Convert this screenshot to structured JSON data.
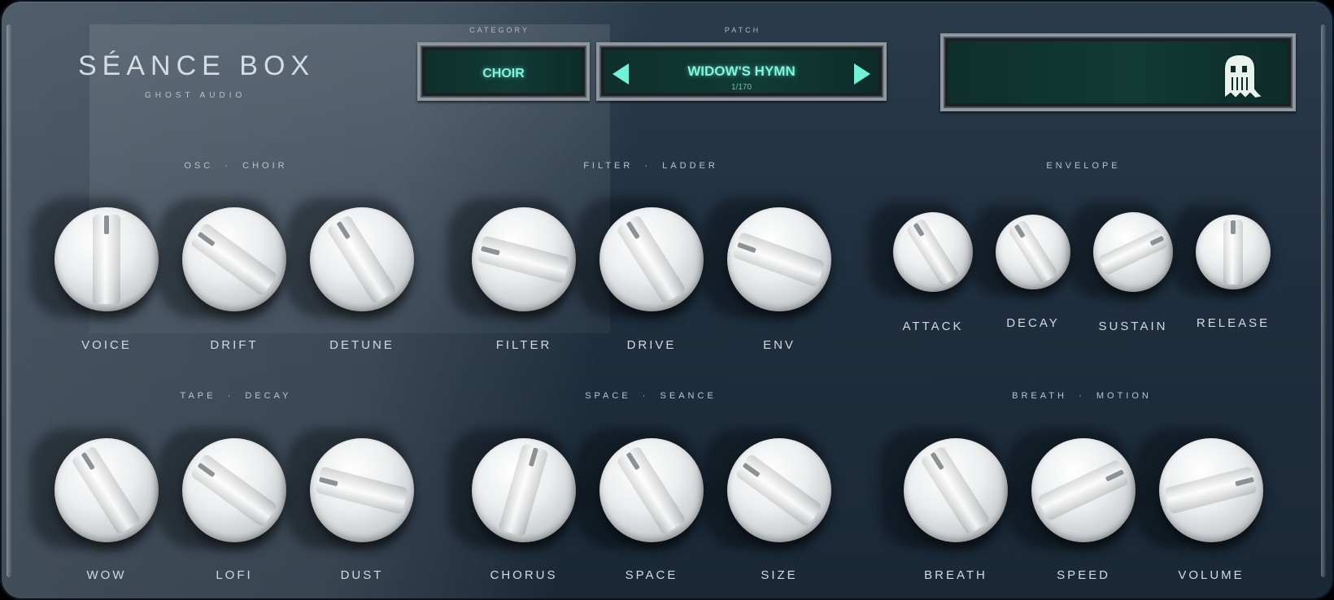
{
  "brand": {
    "title": "SÉANCE BOX",
    "subtitle": "GHOST AUDIO"
  },
  "category": {
    "label": "CATEGORY",
    "value": "CHOIR"
  },
  "patch": {
    "label": "PATCH",
    "name": "WIDOW'S HYMN",
    "index": "1/170",
    "prev_icon": "triangle-left-icon",
    "next_icon": "triangle-right-icon"
  },
  "display": {
    "icon": "ghost-icon"
  },
  "colors": {
    "panel": "#1f2f3f",
    "lcd": "#123a34",
    "lcd_text": "#7ff5df",
    "knob": "#eceeef"
  },
  "sections": {
    "osc": "OSC  ·  CHOIR",
    "filter": "FILTER  ·  LADDER",
    "envelope": "ENVELOPE",
    "tape": "TAPE  ·  DECAY",
    "space": "SPACE  ·  SEANCE",
    "breath": "BREATH  ·  MOTION"
  },
  "knobs": [
    {
      "label": "VOICE",
      "value": 0.5
    },
    {
      "label": "DRIFT",
      "value": 0.3
    },
    {
      "label": "DETUNE",
      "value": 0.38
    },
    {
      "label": "FILTER",
      "value": 0.22
    },
    {
      "label": "DRIVE",
      "value": 0.38
    },
    {
      "label": "ENV",
      "value": 0.24
    },
    {
      "label": "ATTACK",
      "value": 0.38
    },
    {
      "label": "DECAY",
      "value": 0.38
    },
    {
      "label": "SUSTAIN",
      "value": 0.74
    },
    {
      "label": "RELEASE",
      "value": 0.5
    },
    {
      "label": "WOW",
      "value": 0.38
    },
    {
      "label": "LOFI",
      "value": 0.3
    },
    {
      "label": "DUST",
      "value": 0.22
    },
    {
      "label": "CHORUS",
      "value": 0.56
    },
    {
      "label": "SPACE",
      "value": 0.38
    },
    {
      "label": "SIZE",
      "value": 0.3
    },
    {
      "label": "BREATH",
      "value": 0.38
    },
    {
      "label": "SPEED",
      "value": 0.74
    },
    {
      "label": "VOLUME",
      "value": 0.78
    }
  ]
}
